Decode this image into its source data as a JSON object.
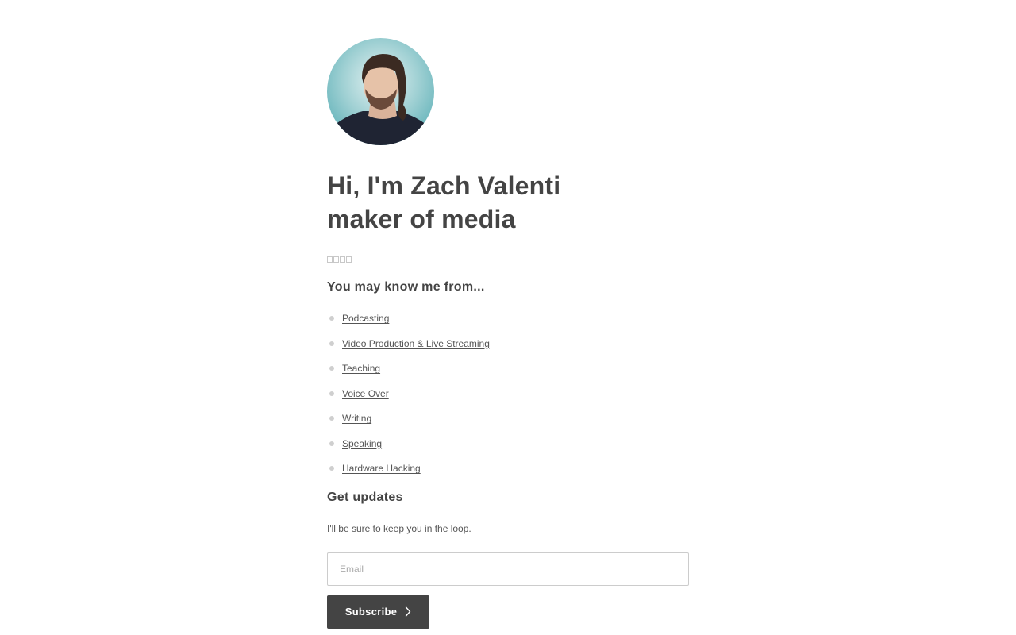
{
  "profile": {
    "avatar_alt": "Zach Valenti",
    "heading_line1": "Hi, I'm Zach Valenti",
    "heading_line2": "maker of media"
  },
  "social_icons": [
    "icon-1",
    "icon-2",
    "icon-3",
    "icon-4"
  ],
  "know_me": {
    "title": "You may know me from...",
    "items": [
      {
        "label": "Podcasting"
      },
      {
        "label": "Video Production & Live Streaming"
      },
      {
        "label": "Teaching"
      },
      {
        "label": "Voice Over"
      },
      {
        "label": "Writing"
      },
      {
        "label": "Speaking"
      },
      {
        "label": "Hardware Hacking"
      }
    ]
  },
  "updates": {
    "title": "Get updates",
    "text": "I'll be sure to keep you in the loop.",
    "email_placeholder": "Email",
    "email_value": "",
    "subscribe_label": "Subscribe"
  },
  "colors": {
    "text": "#444444",
    "button_bg": "#444444",
    "bullet": "#cfcfcf",
    "avatar_bg": "#7cc4c9"
  }
}
